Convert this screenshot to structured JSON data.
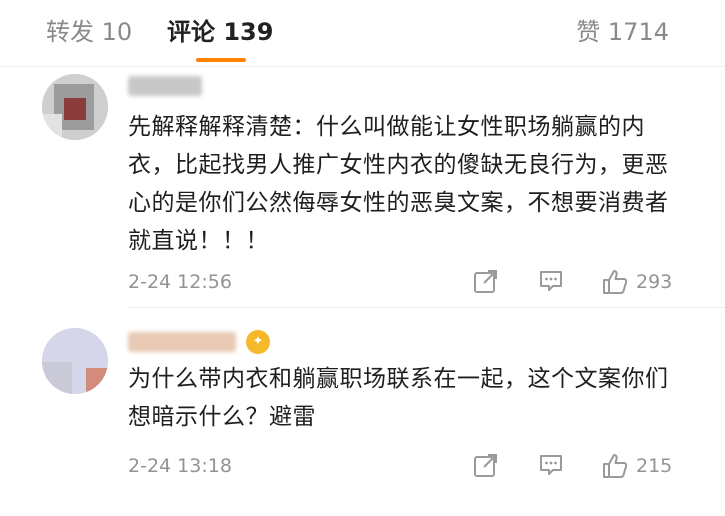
{
  "tabs": {
    "repost": "转发 10",
    "comments": "评论 139",
    "likes": "赞 1714",
    "active": "comments",
    "accent_color": "#ff8200"
  },
  "comments": [
    {
      "username": "",
      "username_blurred": true,
      "text": "先解释解释清楚：什么叫做能让女性职场躺赢的内衣，比起找男人推广女性内衣的傻缺无良行为，更恶心的是你们公然侮辱女性的恶臭文案，不想要消费者就直说！！！",
      "timestamp": "2-24 12:56",
      "like_count": "293",
      "actions": [
        "share-icon",
        "comment-icon",
        "thumbs-up-icon"
      ]
    },
    {
      "username": "",
      "username_blurred": true,
      "has_badge": true,
      "text": "为什么带内衣和躺赢职场联系在一起，这个文案你们想暗示什么？避雷",
      "timestamp": "2-24 13:18",
      "like_count": "215",
      "actions": [
        "share-icon",
        "comment-icon",
        "thumbs-up-icon"
      ]
    }
  ]
}
